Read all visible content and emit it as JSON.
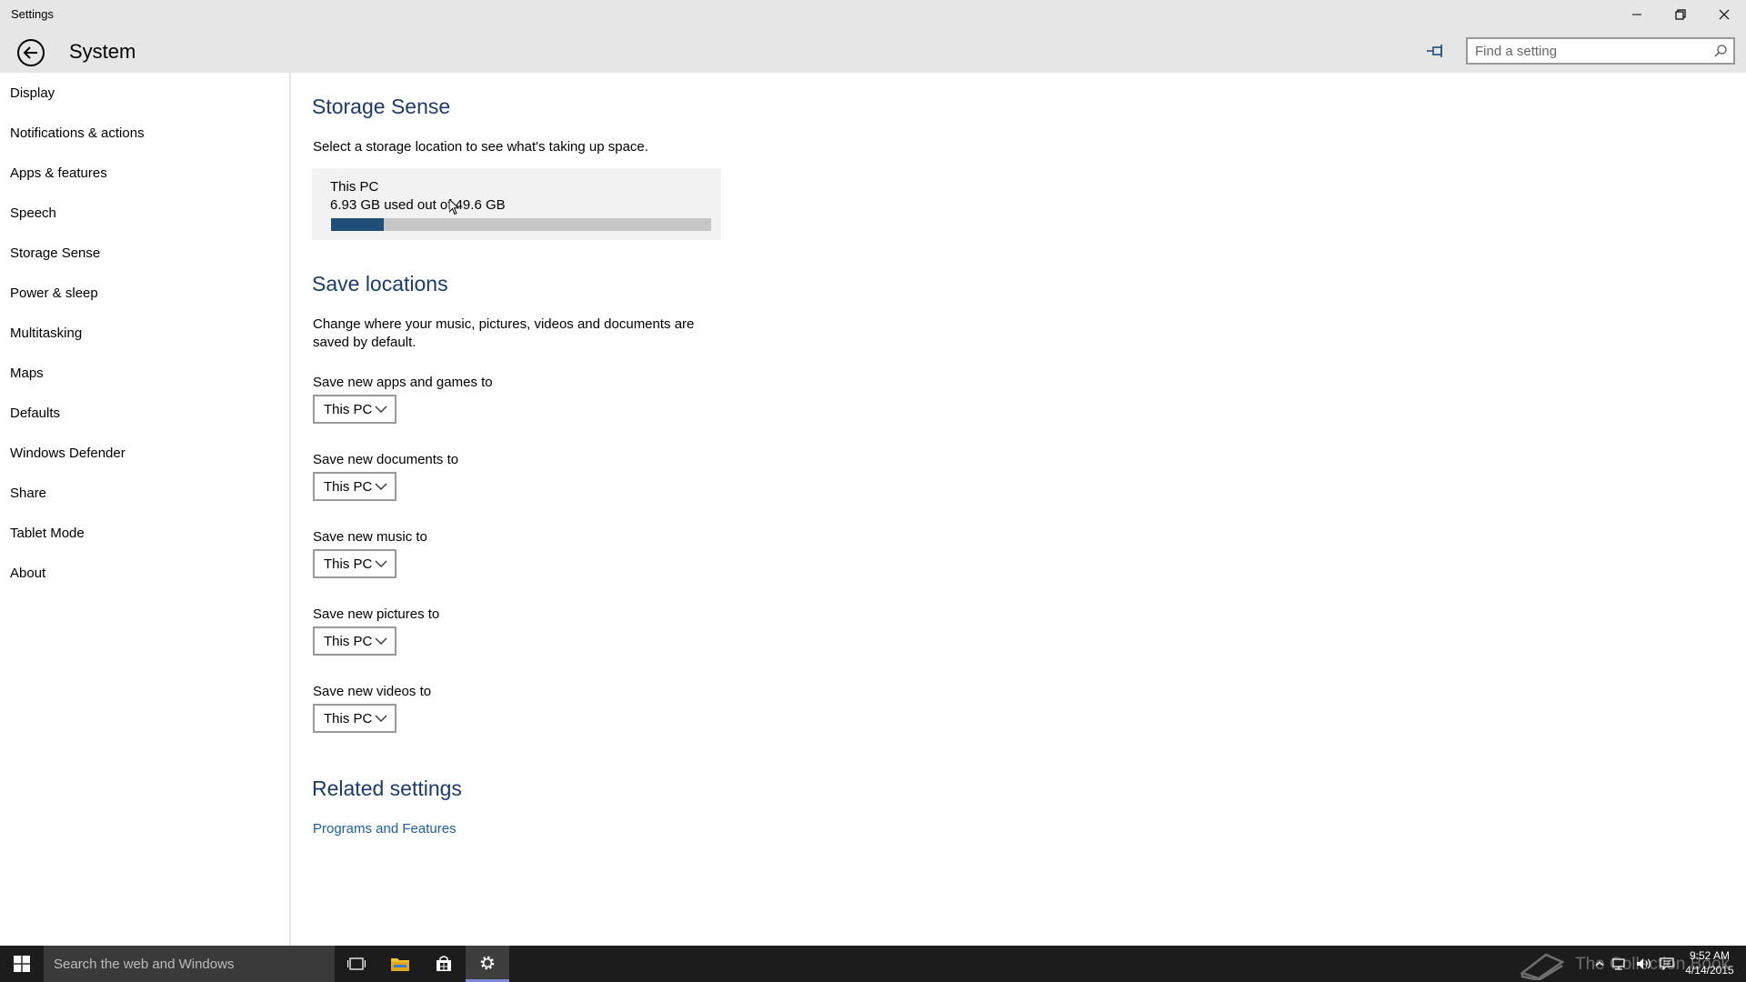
{
  "window": {
    "title": "Settings"
  },
  "header": {
    "title": "System",
    "search_placeholder": "Find a setting"
  },
  "sidebar": {
    "items": [
      {
        "label": "Display"
      },
      {
        "label": "Notifications & actions"
      },
      {
        "label": "Apps & features"
      },
      {
        "label": "Speech"
      },
      {
        "label": "Storage Sense"
      },
      {
        "label": "Power & sleep"
      },
      {
        "label": "Multitasking"
      },
      {
        "label": "Maps"
      },
      {
        "label": "Defaults"
      },
      {
        "label": "Windows Defender"
      },
      {
        "label": "Share"
      },
      {
        "label": "Tablet Mode"
      },
      {
        "label": "About"
      }
    ],
    "selected": "Storage Sense"
  },
  "storage_sense": {
    "heading": "Storage Sense",
    "description": "Select a storage location to see what's taking up space.",
    "drive": {
      "name": "This PC",
      "usage_text": "6.93 GB used out of 49.6 GB",
      "used_fraction": 0.1397
    }
  },
  "save_locations": {
    "heading": "Save locations",
    "description_line1": "Change where your music, pictures, videos and documents are",
    "description_line2": "saved by default.",
    "settings": [
      {
        "label": "Save new apps and games to",
        "value": "This PC"
      },
      {
        "label": "Save new documents to",
        "value": "This PC"
      },
      {
        "label": "Save new music to",
        "value": "This PC"
      },
      {
        "label": "Save new pictures to",
        "value": "This PC"
      },
      {
        "label": "Save new videos to",
        "value": "This PC"
      }
    ]
  },
  "related_settings": {
    "heading": "Related settings",
    "links": [
      {
        "label": "Programs and Features"
      }
    ]
  },
  "taskbar": {
    "search_placeholder": "Search the web and Windows",
    "watermark": "The Collection Book",
    "clock_time": "9:52 AM",
    "clock_date": "4/14/2015"
  },
  "colors": {
    "accent": "#1f4e79",
    "heading": "#1b3b6e",
    "link": "#1b5ea8",
    "chrome": "#e6e6e6",
    "taskbar": "#1c1c1c",
    "active_app": "#7f86d4"
  },
  "icons": {
    "window_minimize": "minimize-icon",
    "window_restore": "restore-icon",
    "window_close": "close-icon",
    "back": "back-arrow-icon",
    "pin": "pin-icon",
    "search": "search-icon",
    "dropdown": "chevron-down-icon",
    "start": "windows-logo-icon",
    "task_view": "task-view-icon",
    "file_explorer": "folder-icon",
    "store": "store-icon",
    "settings": "gear-icon",
    "tray_up": "chevron-up-icon",
    "network": "network-icon",
    "volume": "speaker-icon",
    "action_center": "action-center-icon"
  }
}
